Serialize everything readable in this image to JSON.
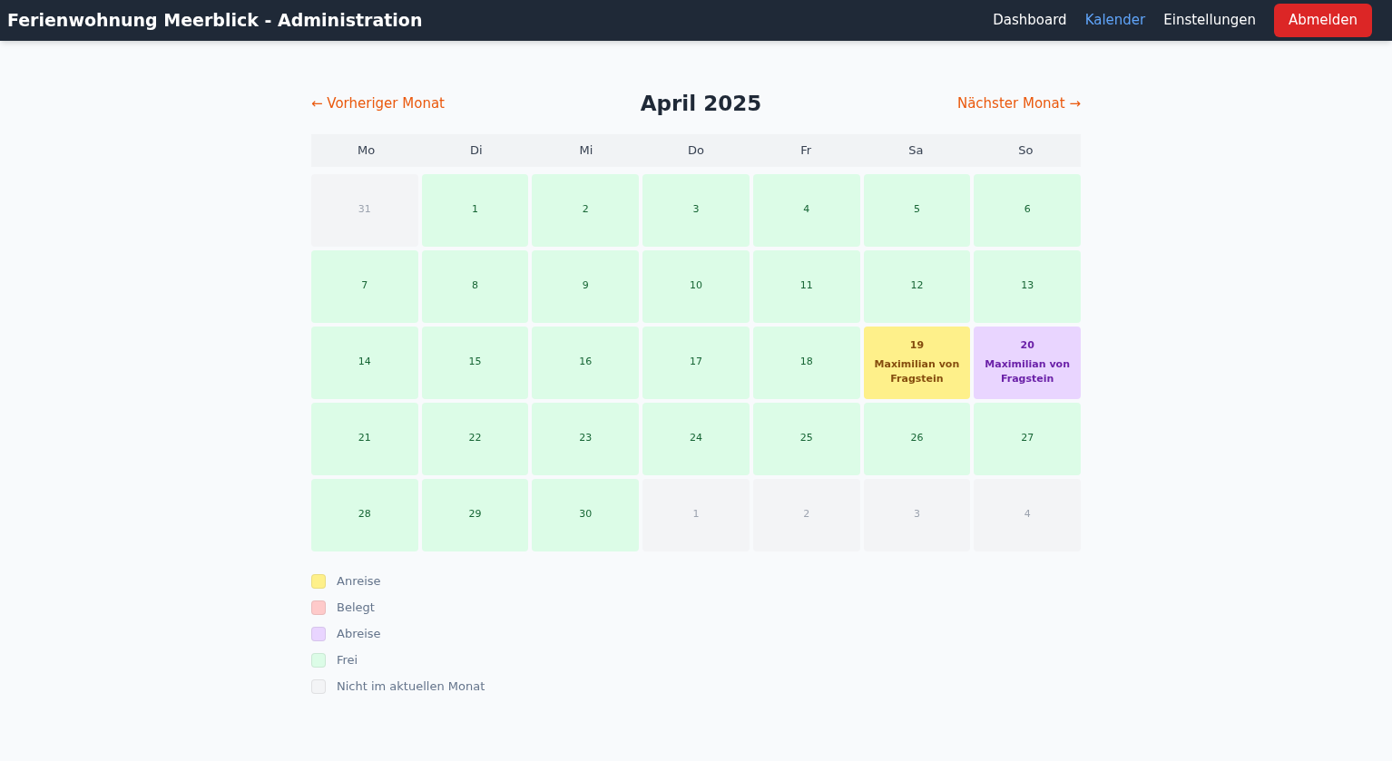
{
  "header": {
    "title": "Ferienwohnung Meerblick - Administration",
    "nav": [
      {
        "label": "Dashboard",
        "selected": false
      },
      {
        "label": "Kalender",
        "selected": true
      },
      {
        "label": "Einstellungen",
        "selected": false
      }
    ],
    "logout": "Abmelden"
  },
  "calendar": {
    "prev": "← Vorheriger Monat",
    "title": "April 2025",
    "next": "Nächster Monat →",
    "weekdays": [
      "Mo",
      "Di",
      "Mi",
      "Do",
      "Fr",
      "Sa",
      "So"
    ],
    "days": [
      {
        "day": "31",
        "kind": "outside"
      },
      {
        "day": "1",
        "kind": "free"
      },
      {
        "day": "2",
        "kind": "free"
      },
      {
        "day": "3",
        "kind": "free"
      },
      {
        "day": "4",
        "kind": "free"
      },
      {
        "day": "5",
        "kind": "free"
      },
      {
        "day": "6",
        "kind": "free"
      },
      {
        "day": "7",
        "kind": "free"
      },
      {
        "day": "8",
        "kind": "free"
      },
      {
        "day": "9",
        "kind": "free"
      },
      {
        "day": "10",
        "kind": "free"
      },
      {
        "day": "11",
        "kind": "free"
      },
      {
        "day": "12",
        "kind": "free"
      },
      {
        "day": "13",
        "kind": "free"
      },
      {
        "day": "14",
        "kind": "free"
      },
      {
        "day": "15",
        "kind": "free"
      },
      {
        "day": "16",
        "kind": "free"
      },
      {
        "day": "17",
        "kind": "free"
      },
      {
        "day": "18",
        "kind": "free"
      },
      {
        "day": "19",
        "kind": "arrival",
        "guest": "Maximilian von Fragstein"
      },
      {
        "day": "20",
        "kind": "departure",
        "guest": "Maximilian von Fragstein"
      },
      {
        "day": "21",
        "kind": "free"
      },
      {
        "day": "22",
        "kind": "free"
      },
      {
        "day": "23",
        "kind": "free"
      },
      {
        "day": "24",
        "kind": "free"
      },
      {
        "day": "25",
        "kind": "free"
      },
      {
        "day": "26",
        "kind": "free"
      },
      {
        "day": "27",
        "kind": "free"
      },
      {
        "day": "28",
        "kind": "free"
      },
      {
        "day": "29",
        "kind": "free"
      },
      {
        "day": "30",
        "kind": "free"
      },
      {
        "day": "1",
        "kind": "outside"
      },
      {
        "day": "2",
        "kind": "outside"
      },
      {
        "day": "3",
        "kind": "outside"
      },
      {
        "day": "4",
        "kind": "outside"
      }
    ]
  },
  "legend": [
    {
      "label": "Anreise",
      "color": "#fef08a"
    },
    {
      "label": "Belegt",
      "color": "#fecaca"
    },
    {
      "label": "Abreise",
      "color": "#e9d5ff"
    },
    {
      "label": "Frei",
      "color": "#dcfce7"
    },
    {
      "label": "Nicht im aktuellen Monat",
      "color": "#f3f4f6"
    }
  ]
}
